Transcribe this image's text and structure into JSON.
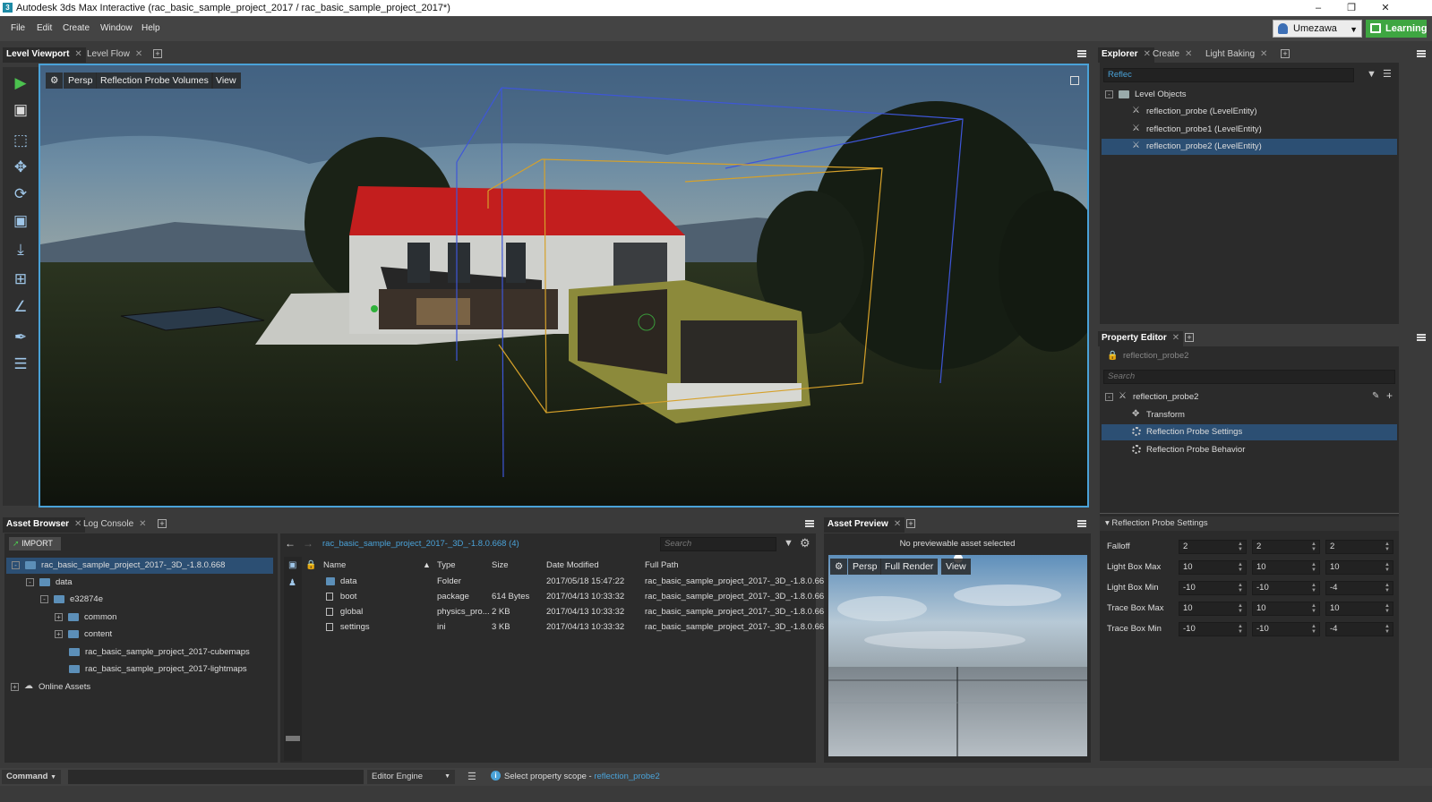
{
  "window": {
    "title": "Autodesk 3ds Max Interactive (rac_basic_sample_project_2017 / rac_basic_sample_project_2017*)"
  },
  "menu": [
    "File",
    "Edit",
    "Create",
    "Window",
    "Help"
  ],
  "user": {
    "name": "Umezawa"
  },
  "learning_label": "Learning",
  "viewport_tabs": [
    "Level Viewport",
    "Level Flow"
  ],
  "viewport": {
    "camera": "Persp",
    "mode": "Reflection Probe Volumes",
    "view": "View"
  },
  "explorer": {
    "tabs": [
      "Explorer",
      "Create",
      "Light Baking"
    ],
    "search_value": "Reflec",
    "root": "Level Objects",
    "items": [
      "reflection_probe (LevelEntity)",
      "reflection_probe1 (LevelEntity)",
      "reflection_probe2 (LevelEntity)"
    ]
  },
  "property_editor": {
    "tab": "Property Editor",
    "name_value": "reflection_probe2",
    "search_placeholder": "Search",
    "root": "reflection_probe2",
    "components": [
      "Transform",
      "Reflection Probe Settings",
      "Reflection Probe Behavior"
    ],
    "section": "Reflection Probe Settings",
    "rows": [
      {
        "label": "Falloff",
        "values": [
          "2",
          "2",
          "2"
        ]
      },
      {
        "label": "Light Box Max",
        "values": [
          "10",
          "10",
          "10"
        ]
      },
      {
        "label": "Light Box Min",
        "values": [
          "-10",
          "-10",
          "-4"
        ]
      },
      {
        "label": "Trace Box Max",
        "values": [
          "10",
          "10",
          "10"
        ]
      },
      {
        "label": "Trace Box Min",
        "values": [
          "-10",
          "-10",
          "-4"
        ]
      }
    ]
  },
  "asset_browser": {
    "tabs": [
      "Asset Browser",
      "Log Console"
    ],
    "import_label": "IMPORT",
    "path": "rac_basic_sample_project_2017-_3D_-1.8.0.668 (4)",
    "search_placeholder": "Search",
    "tree": {
      "root": "rac_basic_sample_project_2017-_3D_-1.8.0.668",
      "data": "data",
      "e": "e32874e",
      "common": "common",
      "content": "content",
      "cubemaps": "rac_basic_sample_project_2017-cubemaps",
      "lightmaps": "rac_basic_sample_project_2017-lightmaps",
      "online": "Online Assets"
    },
    "columns": [
      "Name",
      "Type",
      "Size",
      "Date Modified",
      "Full Path"
    ],
    "files": [
      {
        "name": "data",
        "type": "Folder",
        "size": "",
        "date": "2017/05/18 15:47:22",
        "path": "rac_basic_sample_project_2017-_3D_-1.8.0.66..."
      },
      {
        "name": "boot",
        "type": "package",
        "size": "614 Bytes",
        "date": "2017/04/13 10:33:32",
        "path": "rac_basic_sample_project_2017-_3D_-1.8.0.66..."
      },
      {
        "name": "global",
        "type": "physics_pro...",
        "size": "2 KB",
        "date": "2017/04/13 10:33:32",
        "path": "rac_basic_sample_project_2017-_3D_-1.8.0.66..."
      },
      {
        "name": "settings",
        "type": "ini",
        "size": "3 KB",
        "date": "2017/04/13 10:33:32",
        "path": "rac_basic_sample_project_2017-_3D_-1.8.0.66..."
      }
    ]
  },
  "asset_preview": {
    "tab": "Asset Preview",
    "message": "No previewable asset selected",
    "camera": "Persp",
    "mode": "Full Render",
    "view": "View"
  },
  "status": {
    "command": "Command",
    "engine": "Editor Engine",
    "message": "Select property scope - ",
    "link": "reflection_probe2"
  },
  "colors": {
    "accent": "#4aa2d8",
    "selection": "#2c4f73",
    "learning": "#3ea641",
    "link": "#4aa2d8"
  }
}
